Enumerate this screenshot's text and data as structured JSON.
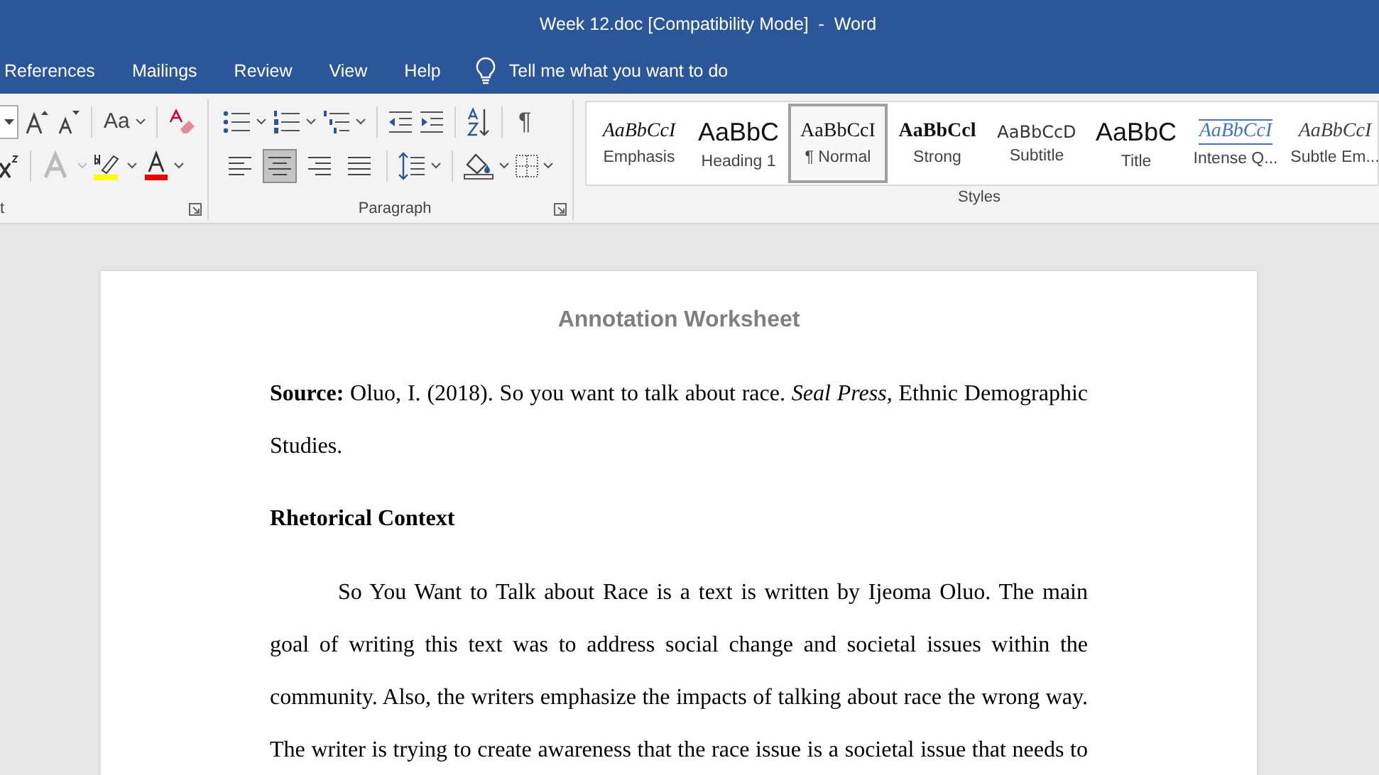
{
  "window": {
    "title": "Week 12.doc [Compatibility Mode]  -  Word"
  },
  "menu_tabs": [
    {
      "label": "References",
      "selected": false
    },
    {
      "label": "Mailings",
      "selected": false
    },
    {
      "label": "Review",
      "selected": false
    },
    {
      "label": "View",
      "selected": false
    },
    {
      "label": "Help",
      "selected": false
    }
  ],
  "tell_me": {
    "placeholder": "Tell me what you want to do"
  },
  "ribbon": {
    "font_group": {
      "label": "t",
      "change_case": "Aa"
    },
    "paragraph_group": {
      "label": "Paragraph",
      "show_marks": "¶",
      "alignment_buttons": [
        {
          "kind": "left",
          "selected": false
        },
        {
          "kind": "center",
          "selected": true
        },
        {
          "kind": "right",
          "selected": false
        },
        {
          "kind": "justify",
          "selected": false
        }
      ]
    },
    "styles_group": {
      "label": "Styles",
      "styles": [
        {
          "kind": "emphasis",
          "sample": "AaBbCcI",
          "name": "Emphasis",
          "selected": false
        },
        {
          "kind": "heading",
          "sample": "AaBbC",
          "name": "Heading 1",
          "selected": false
        },
        {
          "kind": "normal",
          "sample": "AaBbCcI",
          "name": "¶ Normal",
          "selected": true
        },
        {
          "kind": "strong",
          "sample": "AaBbCcl",
          "name": "Strong",
          "selected": false
        },
        {
          "kind": "subtitle",
          "sample": "AaBbCcD",
          "name": "Subtitle",
          "selected": false
        },
        {
          "kind": "title",
          "sample": "AaBbC",
          "name": "Title",
          "selected": false
        },
        {
          "kind": "quote",
          "sample": "AaBbCcI",
          "name": "Intense Q...",
          "selected": false
        },
        {
          "kind": "subtle",
          "sample": "AaBbCcI",
          "name": "Subtle Em...",
          "selected": false
        }
      ]
    }
  },
  "document": {
    "heading": "Annotation Worksheet",
    "paragraphs": [
      {
        "kind": "source",
        "text": "**Source:** Oluo, I. (2018). So you want to talk about race. *Seal Press*, Ethnic Demographic Studies."
      },
      {
        "kind": "section",
        "text": "Rhetorical Context"
      },
      {
        "kind": "body",
        "text": "So You Want to Talk about Race is a text is written by Ijeoma Oluo. The main goal of writing this text was to address social change and societal issues within the community. Also, the writers emphasize the impacts of talking about race the wrong way. The writer is trying to create awareness that the race issue is a societal issue that needs to"
      }
    ]
  }
}
